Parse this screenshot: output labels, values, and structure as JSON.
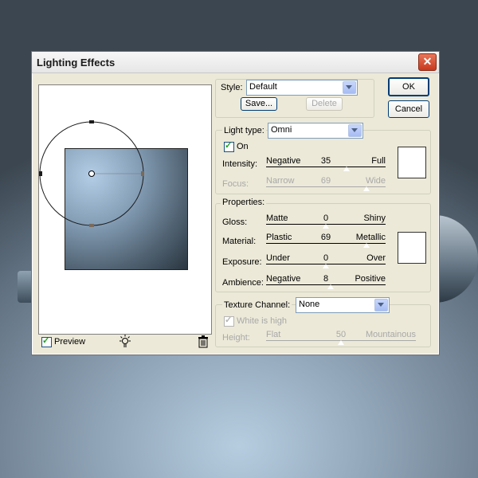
{
  "dialog": {
    "title": "Lighting Effects",
    "close_glyph": "✕"
  },
  "preview": {
    "checkbox_label": "Preview",
    "checked": true
  },
  "style": {
    "label": "Style:",
    "value": "Default",
    "save_label": "Save...",
    "delete_label": "Delete"
  },
  "buttons": {
    "ok": "OK",
    "cancel": "Cancel"
  },
  "light_type": {
    "label": "Light type:",
    "value": "Omni",
    "on_label": "On",
    "on_checked": true,
    "intensity": {
      "label": "Intensity:",
      "lo": "Negative",
      "value": "35",
      "hi": "Full",
      "fraction": 0.67
    },
    "focus": {
      "label": "Focus:",
      "lo": "Narrow",
      "value": "69",
      "hi": "Wide",
      "fraction": 0.84
    }
  },
  "properties": {
    "title": "Properties:",
    "gloss": {
      "label": "Gloss:",
      "lo": "Matte",
      "value": "0",
      "hi": "Shiny",
      "fraction": 0.5
    },
    "material": {
      "label": "Material:",
      "lo": "Plastic",
      "value": "69",
      "hi": "Metallic",
      "fraction": 0.84
    },
    "exposure": {
      "label": "Exposure:",
      "lo": "Under",
      "value": "0",
      "hi": "Over",
      "fraction": 0.5
    },
    "ambience": {
      "label": "Ambience:",
      "lo": "Negative",
      "value": "8",
      "hi": "Positive",
      "fraction": 0.54
    }
  },
  "texture": {
    "label": "Texture Channel:",
    "value": "None",
    "white_is_high_label": "White is high",
    "white_is_high_checked": true,
    "height": {
      "label": "Height:",
      "lo": "Flat",
      "value": "50",
      "hi": "Mountainous",
      "fraction": 0.5
    }
  },
  "colors": {
    "title_close": "#d24a2c",
    "swatch_light": "#ffffff",
    "swatch_material": "#ffffff"
  }
}
